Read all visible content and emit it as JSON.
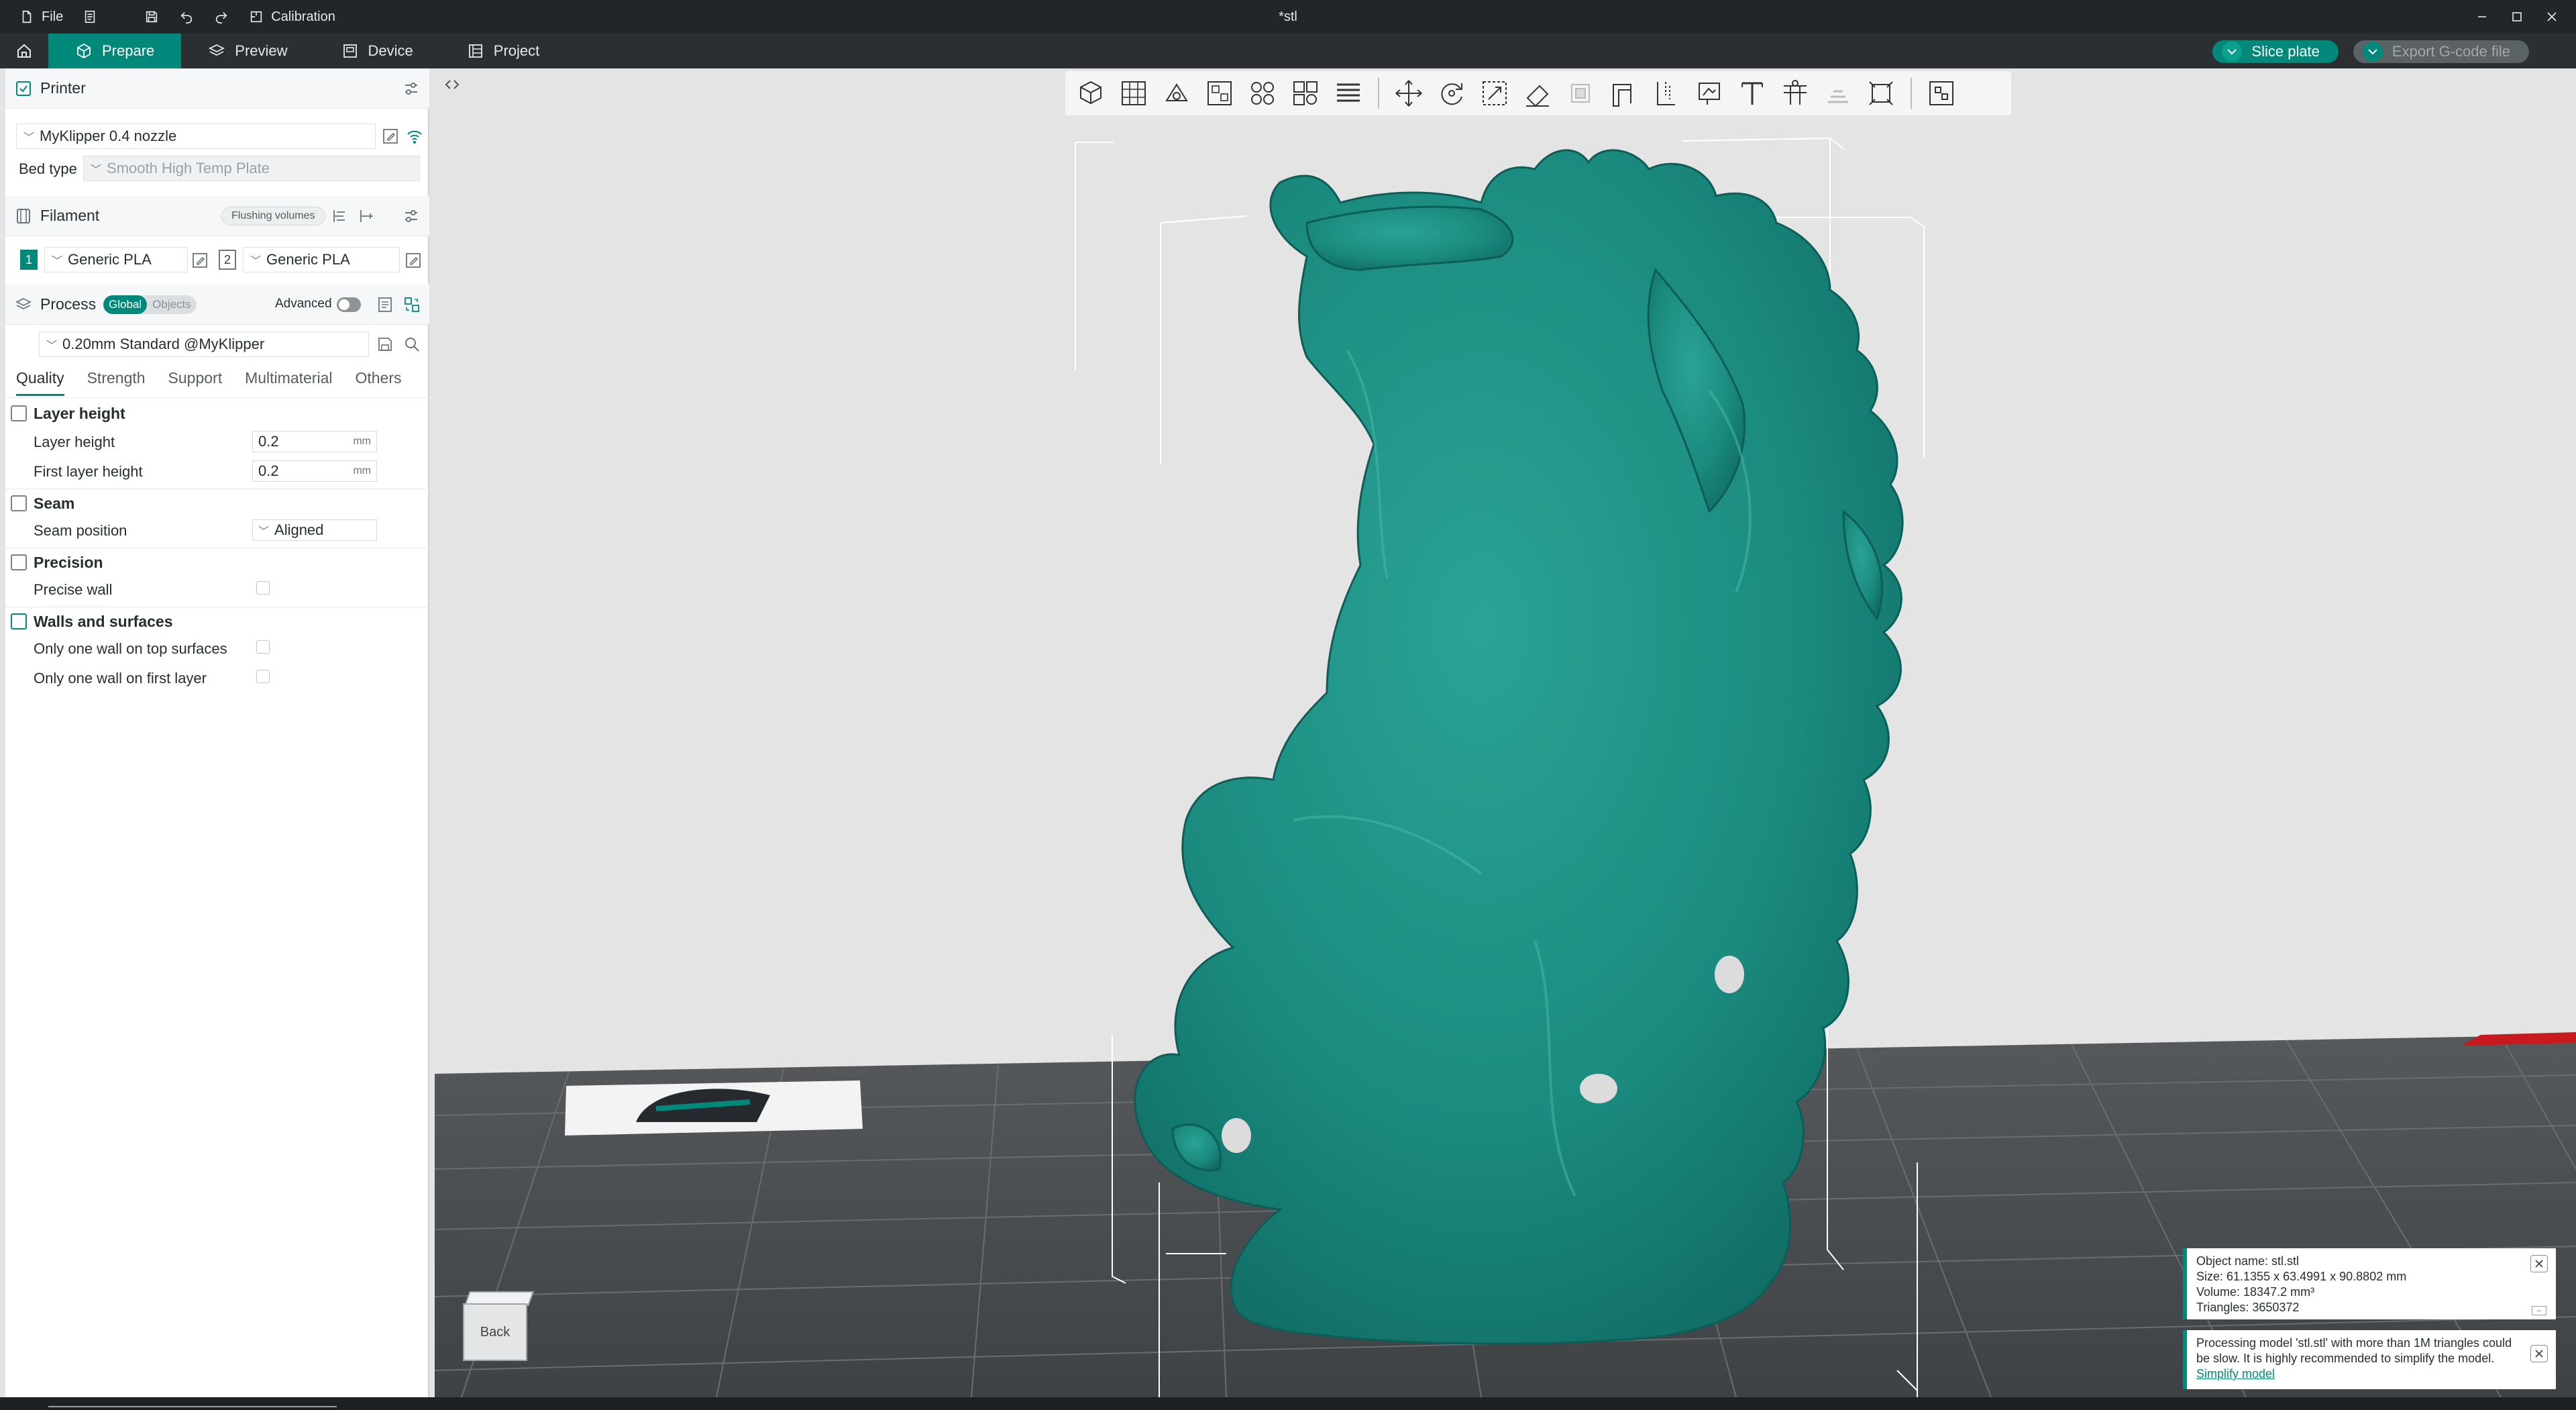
{
  "titlebar": {
    "file_label": "File",
    "calibration_label": "Calibration",
    "document_title": "*stl"
  },
  "tabs": [
    {
      "label": "Prepare",
      "active": true
    },
    {
      "label": "Preview",
      "active": false
    },
    {
      "label": "Device",
      "active": false
    },
    {
      "label": "Project",
      "active": false
    }
  ],
  "actions": {
    "slice_label": "Slice plate",
    "export_label": "Export G-code file"
  },
  "printer": {
    "section_title": "Printer",
    "preset": "MyKlipper 0.4 nozzle",
    "bed_type_label": "Bed type",
    "bed_type_value": "Smooth High Temp Plate"
  },
  "filament": {
    "section_title": "Filament",
    "flushing_label": "Flushing volumes",
    "slots": [
      {
        "num": "1",
        "name": "Generic PLA"
      },
      {
        "num": "2",
        "name": "Generic PLA"
      }
    ]
  },
  "process": {
    "section_title": "Process",
    "global_label": "Global",
    "objects_label": "Objects",
    "advanced_label": "Advanced",
    "preset": "0.20mm Standard @MyKlipper",
    "subtabs": [
      "Quality",
      "Strength",
      "Support",
      "Multimaterial",
      "Others"
    ]
  },
  "quality": {
    "layer_group": "Layer height",
    "layer_height_label": "Layer height",
    "layer_height_value": "0.2",
    "first_layer_label": "First layer height",
    "first_layer_value": "0.2",
    "unit": "mm",
    "seam_group": "Seam",
    "seam_pos_label": "Seam position",
    "seam_pos_value": "Aligned",
    "precision_group": "Precision",
    "precise_wall_label": "Precise wall",
    "walls_group": "Walls and surfaces",
    "one_wall_top_label": "Only one wall on top surfaces",
    "one_wall_first_label": "Only one wall on first layer"
  },
  "viewport": {
    "back_label": "Back"
  },
  "object_info": {
    "name": "Object name: stl.stl",
    "size": "Size: 61.1355 x 63.4991 x 90.8802 mm",
    "volume": "Volume: 18347.2 mm³",
    "triangles": "Triangles: 3650372"
  },
  "warning": {
    "text": "Processing model 'stl.stl' with more than 1M triangles could be slow. It is highly recommended to simplify the model.",
    "link": "Simplify model"
  },
  "colors": {
    "accent": "#00897b",
    "model": "#1e8a80",
    "bed": "#4a4d50"
  }
}
